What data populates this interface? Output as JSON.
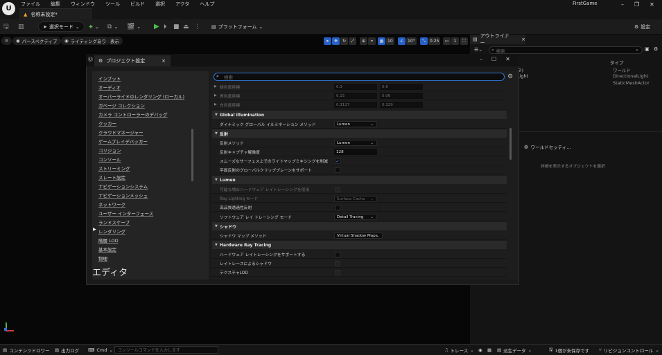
{
  "titlebar": {
    "logo": "U",
    "menu": [
      "ファイル",
      "編集",
      "ウィンドウ",
      "ツール",
      "ビルド",
      "選択",
      "アクタ",
      "ヘルプ"
    ],
    "doc_tab": "名称未設定*",
    "project_name": "FirstGame",
    "win_minimize": "–",
    "win_restore": "❐",
    "win_close": "✕"
  },
  "toolbar": {
    "select_mode": "選択モード",
    "platform": "プラットフォーム",
    "settings": "設定"
  },
  "viewport": {
    "perspective": "パースペクティブ",
    "lighting": "ライティングあり",
    "show": "表示",
    "grid_value": "10",
    "angle_value": "10°",
    "scale_value": "0.25",
    "camera_value": "1"
  },
  "outliner": {
    "tab": "アウトライナー",
    "search_placeholder": "検索",
    "type_header": "タイプ",
    "rows": [
      {
        "name": "タ)",
        "type": "ワールド"
      },
      {
        "name": "Light",
        "type": "DirectionalLight"
      },
      {
        "name": "",
        "type": "StaticMeshActor"
      }
    ]
  },
  "details": {
    "tab": "ワールドセッティ...",
    "empty": "詳細を表示するオブジェクトを選択"
  },
  "project_settings": {
    "tab": "プロジェクト設定",
    "close": "×",
    "search_placeholder": "検索",
    "categories": [
      "インプット",
      "オーディオ",
      "オーバーライドのレンダリング (ローカル)",
      "ガベージ コレクション",
      "カメラ コントローラーのデバッグ",
      "クッカー",
      "クラウドマネージャー",
      "ゲームプレイデバッガー",
      "コリジョン",
      "コンソール",
      "ストリーミング",
      "スレート設定",
      "ナビゲーションシステム",
      "ナビゲーションメッシュ",
      "ネットワーク",
      "ユーザー インターフェース",
      "ランドスケープ",
      "レンダリング",
      "階層 LOD",
      "基本設定",
      "物理"
    ],
    "editor_heading": "エディタ",
    "color_rows": [
      {
        "label": "緑色度座標",
        "a": "0.3",
        "b": "0.6"
      },
      {
        "label": "青色度座標",
        "a": "0.15",
        "b": "0.06"
      },
      {
        "label": "白色度座標",
        "a": "0.3127",
        "b": "0.329"
      }
    ],
    "gi_section": "Global Illumination",
    "gi_method_label": "ダイナミック グローバル イルミネーション メソッド",
    "gi_method_value": "Lumen",
    "reflection_section": "反射",
    "reflection_method_label": "反射メソッド",
    "reflection_method_value": "Lumen",
    "reflection_capture_label": "反射キャプチャ解像度",
    "reflection_capture_value": "128",
    "smooth_label": "スムーズなサーフェス上でのライトマップミキシングを削減",
    "plane_label": "平面反射のグローバルクリッププレーンをサポート",
    "lumen_section": "Lumen",
    "hw_rt_label": "可能な場合ハードウェア レイトレーシングを使用",
    "ray_lighting_label": "Ray Lighting モード",
    "ray_lighting_value": "Surface Cache",
    "hq_trans_label": "高品質透過性反射",
    "sw_rt_label": "ソフトウェア レイ トレーシング モード",
    "sw_rt_value": "Detail Tracing",
    "shadow_section": "シャドウ",
    "shadow_map_label": "シャドウ マップ メソッド",
    "shadow_map_value": "Virtual Shadow Maps",
    "hwrt_section": "Hardware Ray Tracing",
    "hwrt_support_label": "ハードウェア レイトレーシングをサポートする",
    "rt_shadow_label": "レイトレースによるシャドウ",
    "texture_lod_label": "テクスチャLOD"
  },
  "statusbar": {
    "content_drawer": "コンテンツドロワー",
    "output_log": "出力ログ",
    "cmd": "Cmd",
    "cmd_placeholder": "コンソールコマンドを入力します",
    "trace": "トレース",
    "derived_data": "派生データ",
    "unsaved": "1個が未保存です",
    "revision": "リビジョンコントロール"
  }
}
